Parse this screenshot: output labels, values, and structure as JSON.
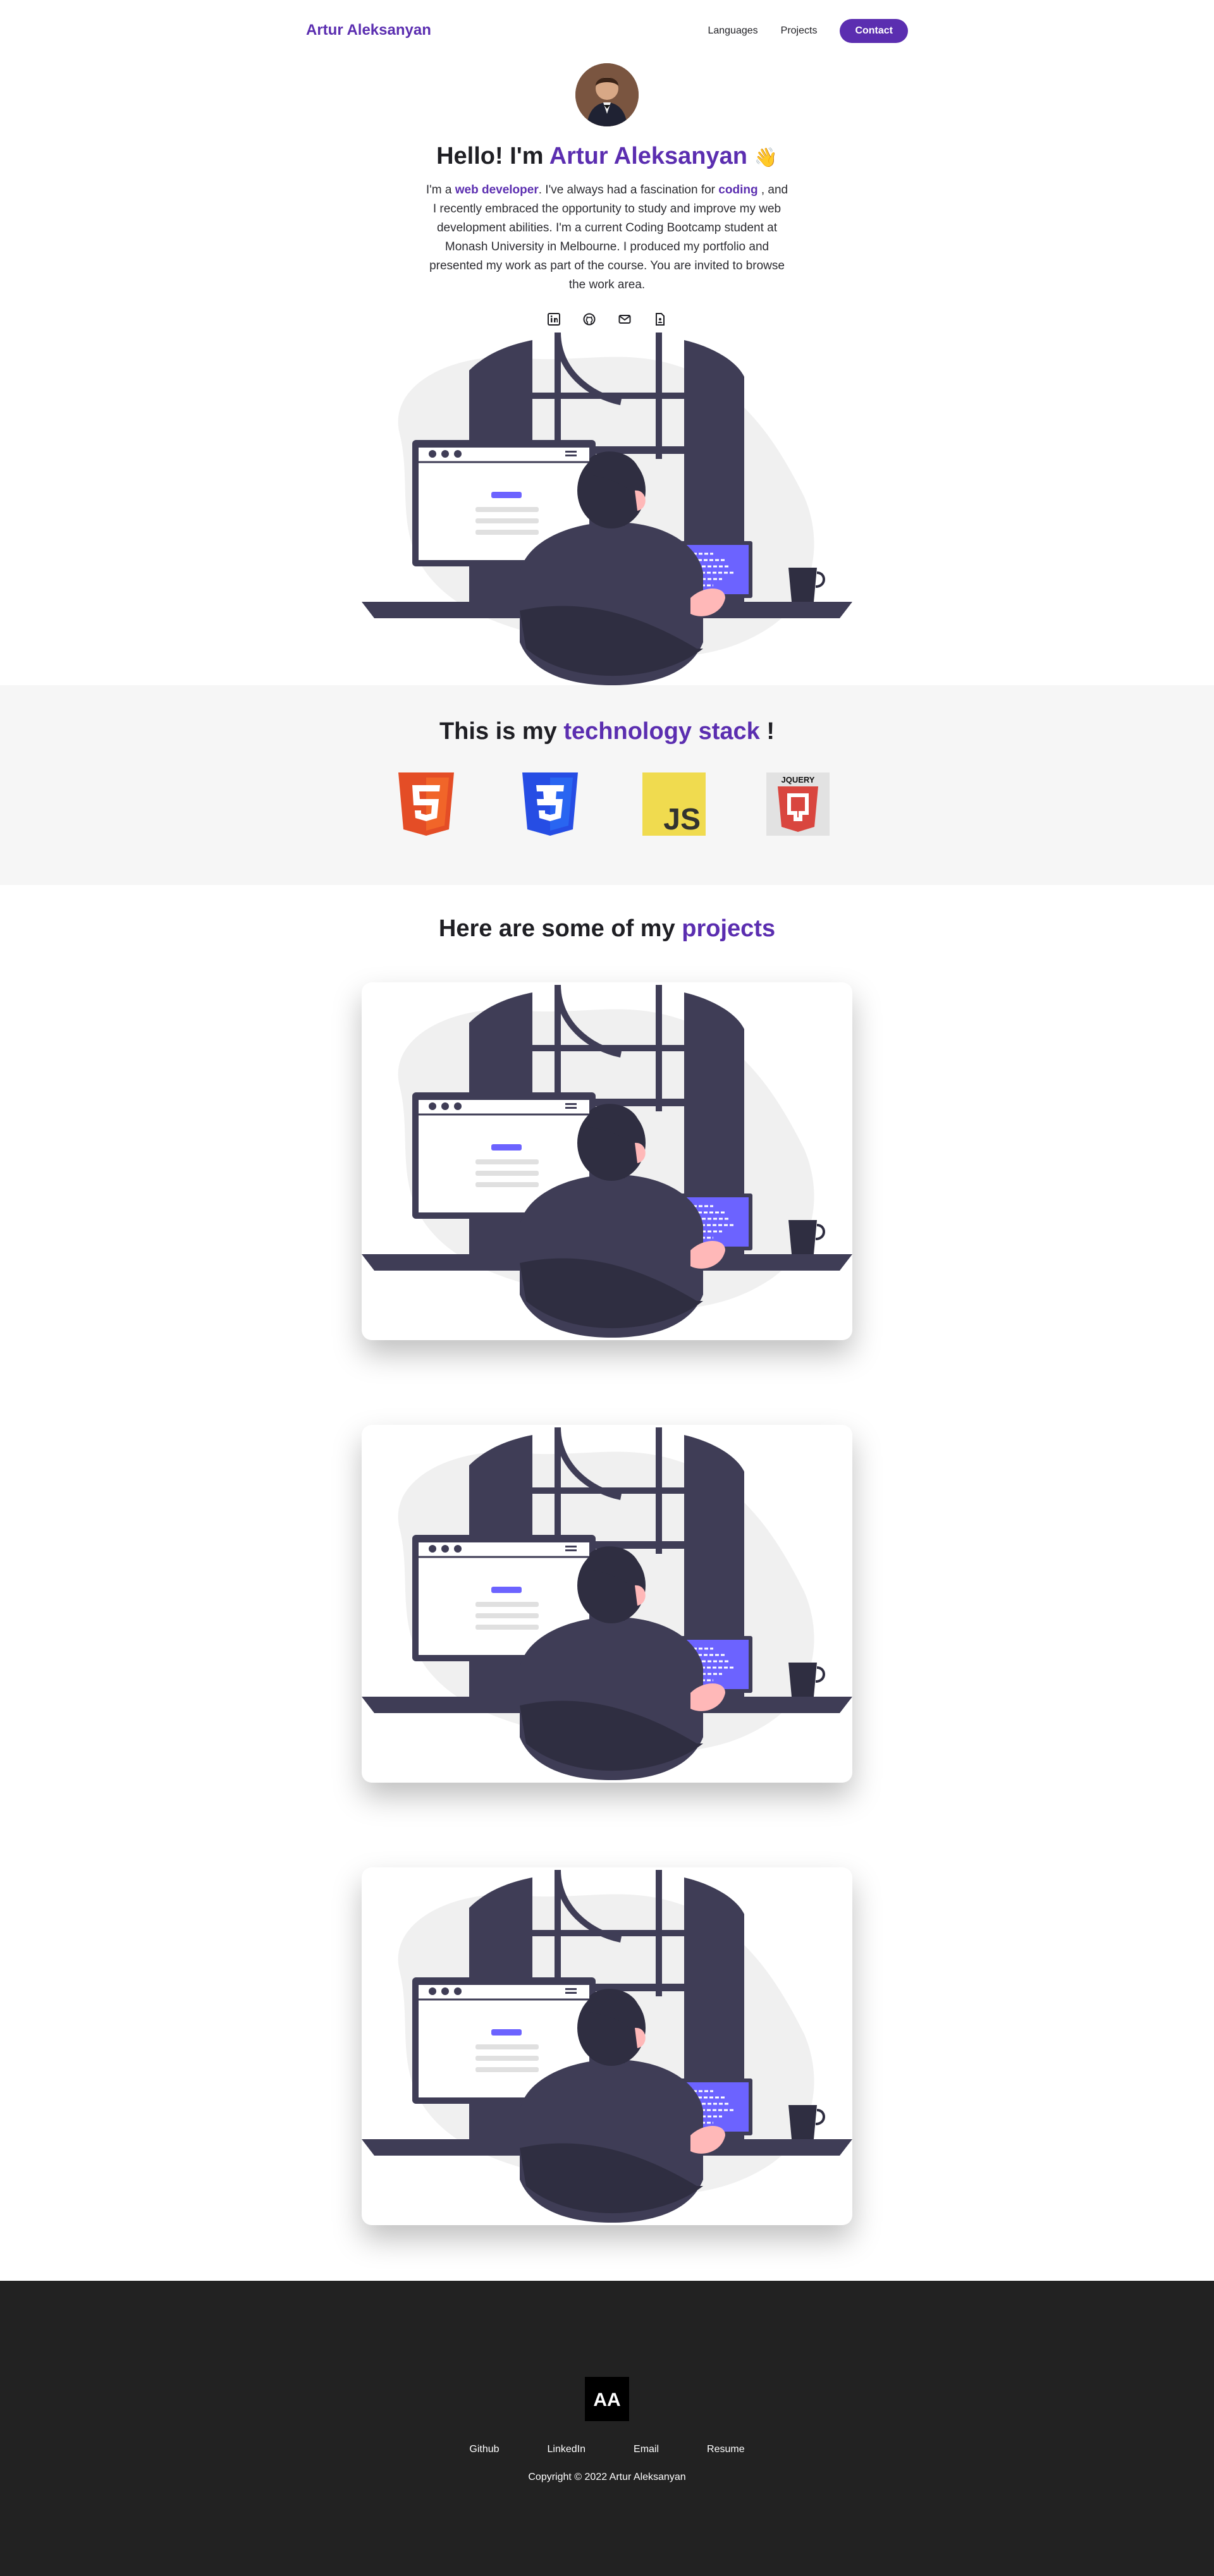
{
  "nav": {
    "brand": "Artur Aleksanyan",
    "links": [
      "Languages",
      "Projects"
    ],
    "contact_label": "Contact"
  },
  "hero": {
    "greeting": "Hello! I'm",
    "name": "Artur Aleksanyan",
    "wave_emoji": "👋",
    "text_part1": "I'm a ",
    "highlight1": "web developer",
    "text_part2": ". I've always had a fascination for ",
    "highlight2": "coding",
    "text_part3": " , and I recently embraced the opportunity to study and improve my web development abilities. I'm a current Coding Bootcamp student at Monash University in Melbourne. I produced my portfolio and presented my work as part of the course. You are invited to browse the work area.",
    "socials": [
      "linkedin-icon",
      "github-icon",
      "email-icon",
      "resume-icon"
    ]
  },
  "tech": {
    "title_prefix": "This is my",
    "title_accent": "technology stack",
    "title_suffix": " !",
    "icons": [
      {
        "icon": "html5-icon",
        "glyph": "5",
        "color": "#e44d26"
      },
      {
        "icon": "css3-icon",
        "glyph": "3",
        "color": "#264de4"
      },
      {
        "icon": "javascript-icon",
        "glyph": "JS",
        "color": "#f0db4f"
      },
      {
        "icon": "jquery-icon",
        "glyph": "JQUERY",
        "color": "#d9463f"
      }
    ]
  },
  "projects": {
    "title_prefix": "Here are some of my",
    "title_accent": "projects"
  },
  "footer": {
    "logo_text": "AA",
    "links": [
      "Github",
      "LinkedIn",
      "Email",
      "Resume"
    ],
    "copyright": "Copyright © 2022 Artur Aleksanyan"
  },
  "colors": {
    "accent": "#5b2eb0",
    "illustration_dark": "#3f3d56",
    "illustration_purple": "#6c63ff",
    "footer_bg": "#222222",
    "tech_bg": "#f6f6f6"
  }
}
